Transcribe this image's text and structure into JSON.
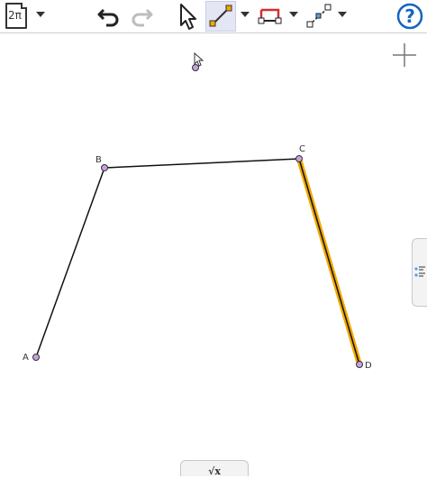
{
  "toolbar": {
    "file_label": "2π",
    "icons": [
      "file-menu-icon",
      "undo-icon",
      "redo-icon",
      "move-pointer-icon",
      "segment-tool-icon",
      "polygon-tool-icon",
      "line-through-points-icon",
      "help-icon"
    ]
  },
  "canvas": {
    "points": [
      {
        "label": "A"
      },
      {
        "label": "B"
      },
      {
        "label": "C"
      },
      {
        "label": "D"
      }
    ],
    "highlight_color": "#f2a900",
    "point_color": "#c9a0dc"
  },
  "algebra_tab": {
    "label": "√x"
  }
}
